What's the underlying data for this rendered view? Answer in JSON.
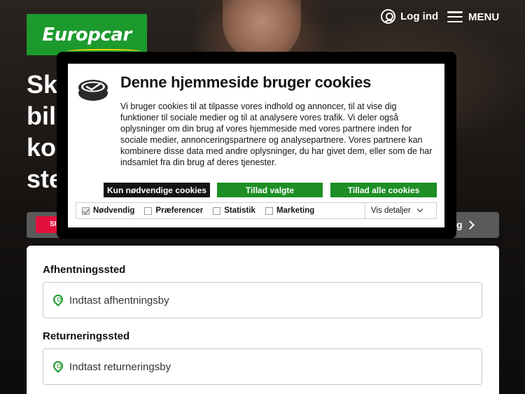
{
  "header": {
    "logo_text": "Europcar",
    "login_label": "Log ind",
    "menu_label": "MENU"
  },
  "hero": {
    "headline_lines": [
      "Sk",
      "bil'",
      "kor",
      "ste"
    ]
  },
  "tabs": {
    "left_partial": "SI",
    "right_partial": "g"
  },
  "booking": {
    "pickup_label": "Afhentningssted",
    "pickup_placeholder": "Indtast afhentningsby",
    "return_label": "Returneringssted",
    "return_placeholder": "Indtast returneringsby"
  },
  "cookie_banner": {
    "title": "Denne hjemmeside bruger cookies",
    "body": "Vi bruger cookies til at tilpasse vores indhold og annoncer, til at vise dig funktioner til sociale medier og til at analysere vores trafik. Vi deler også oplysninger om din brug af vores hjemmeside med vores partnere inden for sociale medier, annonceringspartnere og analysepartnere. Vores partnere kan kombinere disse data med andre oplysninger, du har givet dem, eller som de har indsamlet fra din brug af deres tjenester.",
    "buttons": {
      "necessary_only": "Kun nødvendige cookies",
      "allow_selected": "Tillad valgte",
      "allow_all": "Tillad alle cookies"
    },
    "preferences": [
      {
        "label": "Nødvendig",
        "checked": true
      },
      {
        "label": "Præferencer",
        "checked": false
      },
      {
        "label": "Statistik",
        "checked": false
      },
      {
        "label": "Marketing",
        "checked": false
      }
    ],
    "details_label": "Vis detaljer"
  },
  "colors": {
    "brand_green": "#1d9a2e",
    "button_green": "#1d8f24",
    "accent_red": "#e3103c",
    "dark": "#141414"
  }
}
